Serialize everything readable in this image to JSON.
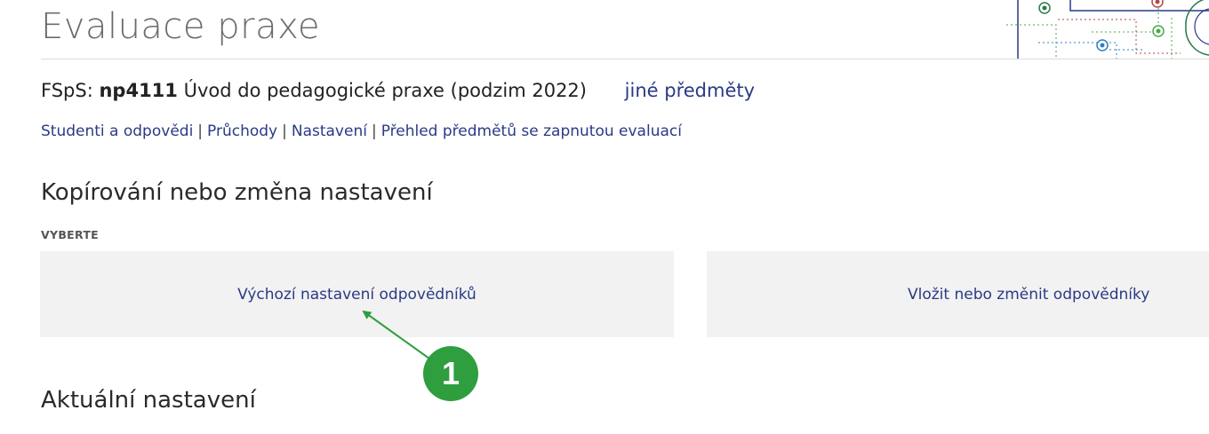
{
  "header": {
    "title": "Evaluace praxe"
  },
  "course": {
    "faculty": "FSpS:",
    "code": "np4111",
    "name": "Úvod do pedagogické praxe (podzim 2022)",
    "other_subjects_link": "jiné předměty"
  },
  "nav": {
    "links": [
      {
        "label": "Studenti a odpovědi"
      },
      {
        "label": "Průchody"
      },
      {
        "label": "Nastavení"
      },
      {
        "label": "Přehled předmětů se zapnutou evaluací"
      }
    ],
    "separator": "|"
  },
  "copy_section": {
    "title": "Kopírování nebo změna nastavení",
    "choose_label": "VYBERTE",
    "options": [
      {
        "label": "Výchozí nastavení odpovědníků"
      },
      {
        "label": "Vložit nebo změnit odpovědníky"
      }
    ]
  },
  "annotation": {
    "number": "1",
    "color": "#2e9e3e"
  },
  "current_section": {
    "title": "Aktuální nastavení"
  }
}
